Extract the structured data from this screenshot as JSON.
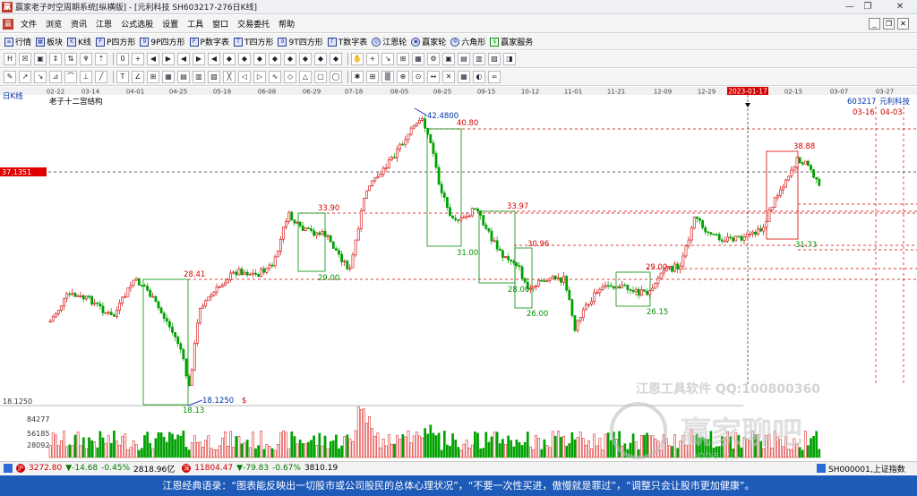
{
  "window": {
    "title": "赢家老子时空周期系统[纵横版] - [元利科技  SH603217-276日K线]",
    "buttons": [
      "—",
      "❐",
      "✕"
    ]
  },
  "menu": {
    "items": [
      "文件",
      "浏览",
      "资讯",
      "江恩",
      "公式选股",
      "设置",
      "工具",
      "窗口",
      "交易委托",
      "帮助"
    ],
    "doc_controls": [
      "_",
      "❐",
      "✕"
    ]
  },
  "toolbar": {
    "items": [
      {
        "icon": "list-icon",
        "label": "行情"
      },
      {
        "icon": "grid-icon",
        "label": "板块"
      },
      {
        "icon": "kline-icon",
        "label": "K线"
      },
      {
        "icon": "square-p-icon",
        "label": "P四方形"
      },
      {
        "icon": "square-9p-icon",
        "label": "9P四方形"
      },
      {
        "icon": "number-p-icon",
        "label": "P数字表"
      },
      {
        "icon": "square-t-icon",
        "label": "T四方形"
      },
      {
        "icon": "square-9t-icon",
        "label": "9T四方形"
      },
      {
        "icon": "number-t-icon",
        "label": "T数字表"
      },
      {
        "icon": "gann-wheel-icon",
        "label": "江恩轮"
      },
      {
        "icon": "winner-wheel-icon",
        "label": "赢家轮"
      },
      {
        "icon": "hexagon-icon",
        "label": "六角形"
      },
      {
        "icon": "service-icon",
        "label": "赢家服务"
      }
    ]
  },
  "drawing_toolbar": {
    "row1": [
      "H",
      "☒",
      "▣",
      "↕",
      "⇅",
      "♆",
      "⇡",
      "0",
      "+",
      "◀",
      "▶",
      "◀",
      "▶",
      "◀",
      "◆",
      "◆",
      "◆",
      "◆",
      "◆",
      "◆",
      "◆",
      "◆",
      "✋",
      "+",
      "↘",
      "⊞",
      "▦",
      "⚙",
      "▣",
      "▤",
      "▥",
      "▧",
      "◨"
    ],
    "row2": [
      "✎",
      "↗",
      "↘",
      "⊿",
      "⌒",
      "⊥",
      "╱",
      "T",
      "∠",
      "⊞",
      "▦",
      "▤",
      "▥",
      "▧",
      "╳",
      "◁",
      "▷",
      "∿",
      "◇",
      "△",
      "▢",
      "◯",
      "✱",
      "⊞",
      "▒",
      "⊕",
      "⊙",
      "↔",
      "✕",
      "▦",
      "◐",
      "∞"
    ]
  },
  "chart": {
    "period_label": "日K线",
    "indicator_label": "老子十二宫结构",
    "stock_code": "603217",
    "stock_name": "元利科技",
    "proj_dates": [
      "03-16",
      "04-03"
    ],
    "current_price": "37.1351",
    "bottom_price": "18.1250",
    "cursor_date": "2023-01-17",
    "x_dates": [
      "02-22",
      "03-14",
      "04-01",
      "04-25",
      "05-18",
      "06-08",
      "06-29",
      "07-18",
      "08-05",
      "08-25",
      "09-15",
      "10-12",
      "11-01",
      "11-21",
      "12-09",
      "12-29",
      "02-15",
      "03-07",
      "03-27"
    ],
    "annotations": [
      "42.4800",
      "40.80",
      "33.90",
      "33.97",
      "30.96",
      "29.00",
      "31.00",
      "28.41",
      "28.00",
      "26.00",
      "29.00",
      "26.15",
      "38.88",
      "31.73",
      "18.1250",
      "18.13",
      "$"
    ],
    "volume_labels": [
      "84277",
      "56185",
      "28092"
    ]
  },
  "watermark": {
    "line1": "江恩工具软件  QQ:100800360",
    "line2": "赢家聊吧",
    "line3": "jiaoba.yjs"
  },
  "status": {
    "sh_index": "3272.80",
    "sh_change": "▼-14.68",
    "sh_pct": "-0.45%",
    "sh_amount": "2818.96亿",
    "sz_index": "11804.47",
    "sz_change": "▼-79.83",
    "sz_pct": "-0.67%",
    "sz_amount": "3810.19",
    "index_code": "SH000001,上证指数"
  },
  "quote": {
    "text": "江恩经典语录：“图表能反映出一切股市或公司股民的总体心理状况”，“不要一次性买进，傲慢就是罪过”，“调整只会让股市更加健康”。"
  },
  "colors": {
    "up": "#d40000",
    "down": "#00a000",
    "grid": "#c80000",
    "quote_bg": "#1e5ab8"
  }
}
